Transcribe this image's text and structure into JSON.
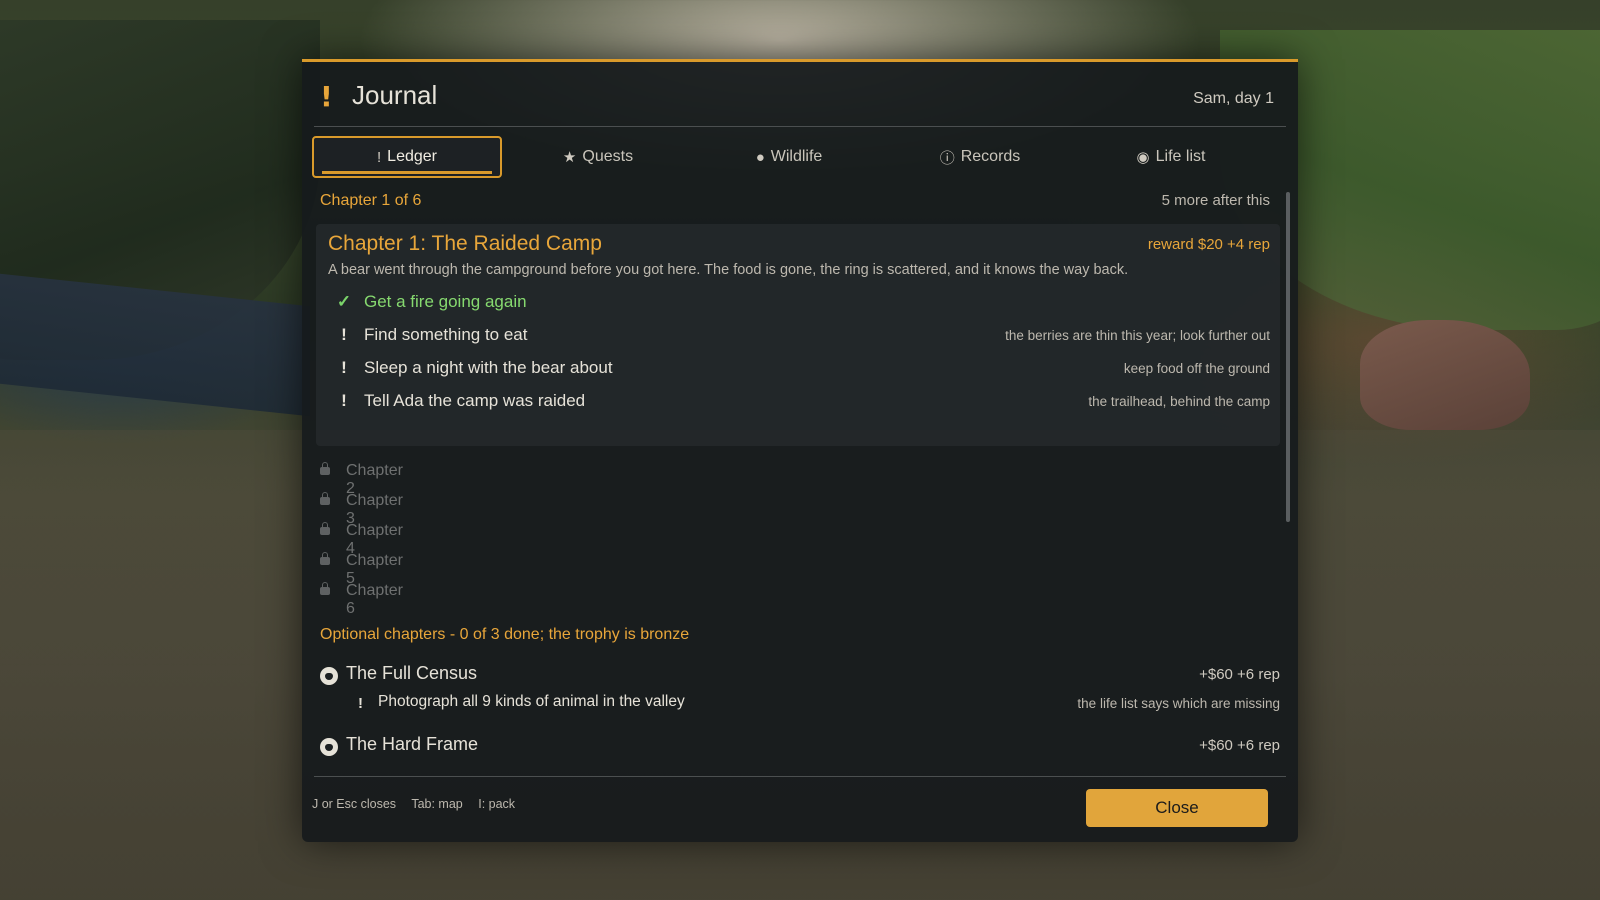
{
  "journal": {
    "title": "Journal",
    "title_icon": "!",
    "subtitle": "Sam, day 1",
    "accent_color": "#d99a2b"
  },
  "tabs": [
    {
      "label": "Ledger",
      "icon": "exclamation-icon",
      "glyph": "!",
      "active": true
    },
    {
      "label": "Quests",
      "icon": "star-icon",
      "glyph": "★",
      "active": false
    },
    {
      "label": "Wildlife",
      "icon": "paw-icon",
      "glyph": "🐾",
      "active": false
    },
    {
      "label": "Records",
      "icon": "info-icon",
      "glyph": "ⓘ",
      "active": false
    },
    {
      "label": "Life list",
      "icon": "camera-icon",
      "glyph": "◉",
      "active": false
    }
  ],
  "ledger": {
    "chapter_line": "Chapter 1 of 6",
    "more_line": "5 more after this",
    "current": {
      "title": "Chapter 1: The Raided Camp",
      "reward": "reward $20  +4 rep",
      "description": "A bear went through the campground before you got here. The food is gone, the ring is scattered, and it knows the way back.",
      "objectives": [
        {
          "text": "Get a fire going again",
          "hint": "",
          "done": true,
          "icon": "check-icon",
          "glyph": "✓"
        },
        {
          "text": "Find something to eat",
          "hint": "the berries are thin this year; look further out",
          "done": false,
          "icon": "exclamation-icon",
          "glyph": "!"
        },
        {
          "text": "Sleep a night with the bear about",
          "hint": "keep food off the ground",
          "done": false,
          "icon": "exclamation-icon",
          "glyph": "!"
        },
        {
          "text": "Tell Ada the camp was raided",
          "hint": "the trailhead, behind the camp",
          "done": false,
          "icon": "exclamation-icon",
          "glyph": "!"
        }
      ]
    },
    "locked": [
      "Chapter 2",
      "Chapter 3",
      "Chapter 4",
      "Chapter 5",
      "Chapter 6"
    ],
    "optional_header": "Optional chapters - 0 of 3 done; the trophy is bronze",
    "optional": [
      {
        "title": "The Full Census",
        "reward": "+$60  +6 rep",
        "objective": "Photograph all 9 kinds of animal in the valley",
        "hint": "the life list says which are missing",
        "objective_glyph": "!"
      },
      {
        "title": "The Hard Frame",
        "reward": "+$60  +6 rep"
      }
    ]
  },
  "footer": {
    "keys": [
      "J or Esc closes",
      "Tab: map",
      "I: pack"
    ],
    "close_label": "Close"
  }
}
